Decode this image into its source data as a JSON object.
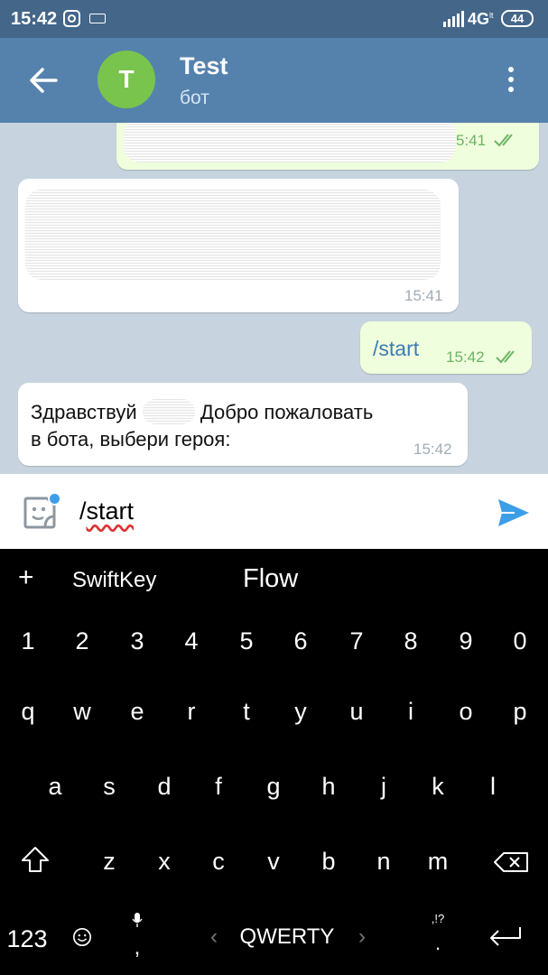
{
  "status_bar": {
    "time": "15:42",
    "network": "4G",
    "network_sub": "lt",
    "battery": "44"
  },
  "header": {
    "avatar_letter": "T",
    "title": "Test",
    "subtitle": "бот",
    "avatar_color": "#79c44c"
  },
  "messages": [
    {
      "direction": "out",
      "text": "",
      "time": "5:41",
      "read": true
    },
    {
      "direction": "in",
      "text": "",
      "time": "15:41"
    },
    {
      "direction": "out",
      "text": "/start",
      "time": "15:42",
      "read": true
    },
    {
      "direction": "in",
      "line1_a": "Здравствуй",
      "line1_b": "Добро пожаловать",
      "line2": "в бота, выбери героя:",
      "time": "15:42"
    }
  ],
  "input": {
    "value": "/start"
  },
  "keyboard": {
    "suggestions": [
      "+",
      "SwiftKey",
      "Flow"
    ],
    "numbers": [
      "1",
      "2",
      "3",
      "4",
      "5",
      "6",
      "7",
      "8",
      "9",
      "0"
    ],
    "row1": [
      "q",
      "w",
      "e",
      "r",
      "t",
      "y",
      "u",
      "i",
      "o",
      "p"
    ],
    "row2": [
      "a",
      "s",
      "d",
      "f",
      "g",
      "h",
      "j",
      "k",
      "l"
    ],
    "row3": [
      "z",
      "x",
      "c",
      "v",
      "b",
      "n",
      "m"
    ],
    "bottom": {
      "num_key": "123",
      "comma": ",",
      "layout_label": "QWERTY",
      "punct_top": ",!?",
      "punct": "."
    }
  },
  "colors": {
    "header_bg": "#5582ad",
    "status_bg": "#446689",
    "chat_bg": "#c7d4df",
    "out_bubble": "#effedd",
    "accent": "#3d9ee8"
  }
}
